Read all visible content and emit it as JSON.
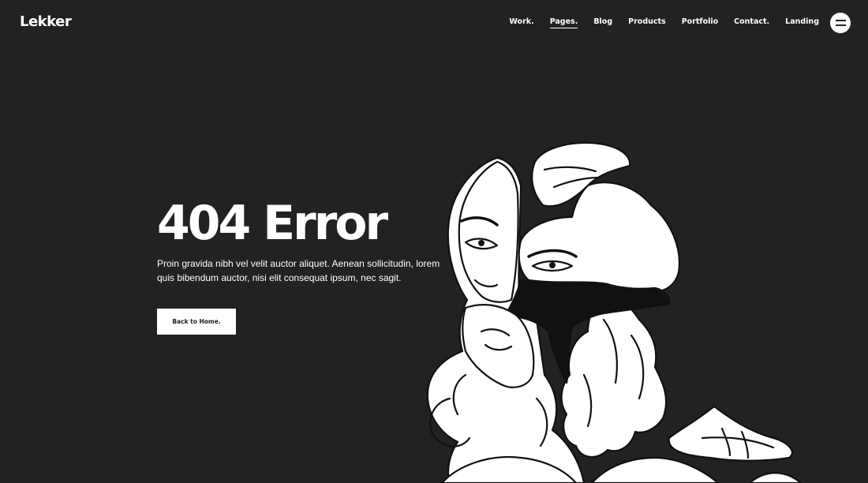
{
  "brand": {
    "logo": "Lekker"
  },
  "nav": {
    "items": [
      {
        "label": "Work."
      },
      {
        "label": "Pages."
      },
      {
        "label": "Blog"
      },
      {
        "label": "Products"
      },
      {
        "label": "Portfolio"
      },
      {
        "label": "Contact."
      },
      {
        "label": "Landing"
      }
    ],
    "active": "Pages."
  },
  "hero": {
    "title": "404 Error",
    "description": "Proin gravida nibh vel velit auctor aliquet. Aenean sollicitudin, lorem quis bibendum auctor, nisi elit consequat ipsum, nec sagit.",
    "button_label": "Back to Home."
  },
  "colors": {
    "background": "#222222",
    "foreground": "#ffffff"
  },
  "icons": {
    "menu": "hamburger-menu-icon",
    "illustration": "two-women-line-art-illustration"
  }
}
